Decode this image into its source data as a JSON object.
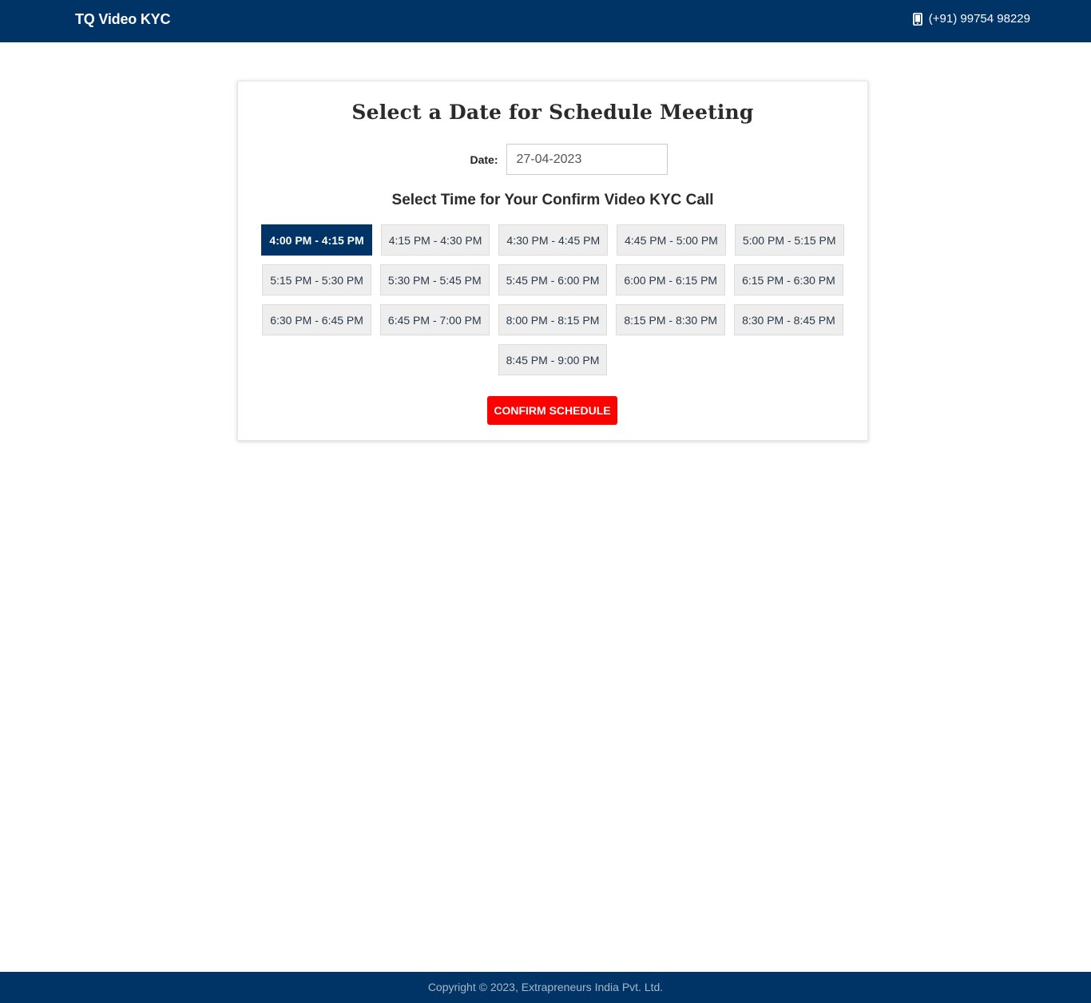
{
  "header": {
    "brand": "TQ Video KYC",
    "phone_icon": "mobile-phone-icon",
    "phone": "(+91) 99754 98229"
  },
  "form": {
    "title": "Select a Date for Schedule Meeting",
    "date_label": "Date:",
    "date_value": "27-04-2023",
    "time_heading": "Select Time for Your Confirm Video KYC Call",
    "selected_slot": "4:00 PM - 4:15 PM",
    "slots": [
      "4:00 PM - 4:15 PM",
      "4:15 PM - 4:30 PM",
      "4:30 PM - 4:45 PM",
      "4:45 PM - 5:00 PM",
      "5:00 PM - 5:15 PM",
      "5:15 PM - 5:30 PM",
      "5:30 PM - 5:45 PM",
      "5:45 PM - 6:00 PM",
      "6:00 PM - 6:15 PM",
      "6:15 PM - 6:30 PM",
      "6:30 PM - 6:45 PM",
      "6:45 PM - 7:00 PM",
      "8:00 PM - 8:15 PM",
      "8:15 PM - 8:30 PM",
      "8:30 PM - 8:45 PM",
      "8:45 PM - 9:00 PM"
    ],
    "confirm_label": "CONFIRM SCHEDULE"
  },
  "footer": {
    "copyright": "Copyright © 2023, Extrapreneurs India Pvt. Ltd."
  },
  "colors": {
    "primary": "#003366",
    "accent": "#ff0000",
    "slot_bg": "#eeeeee"
  }
}
